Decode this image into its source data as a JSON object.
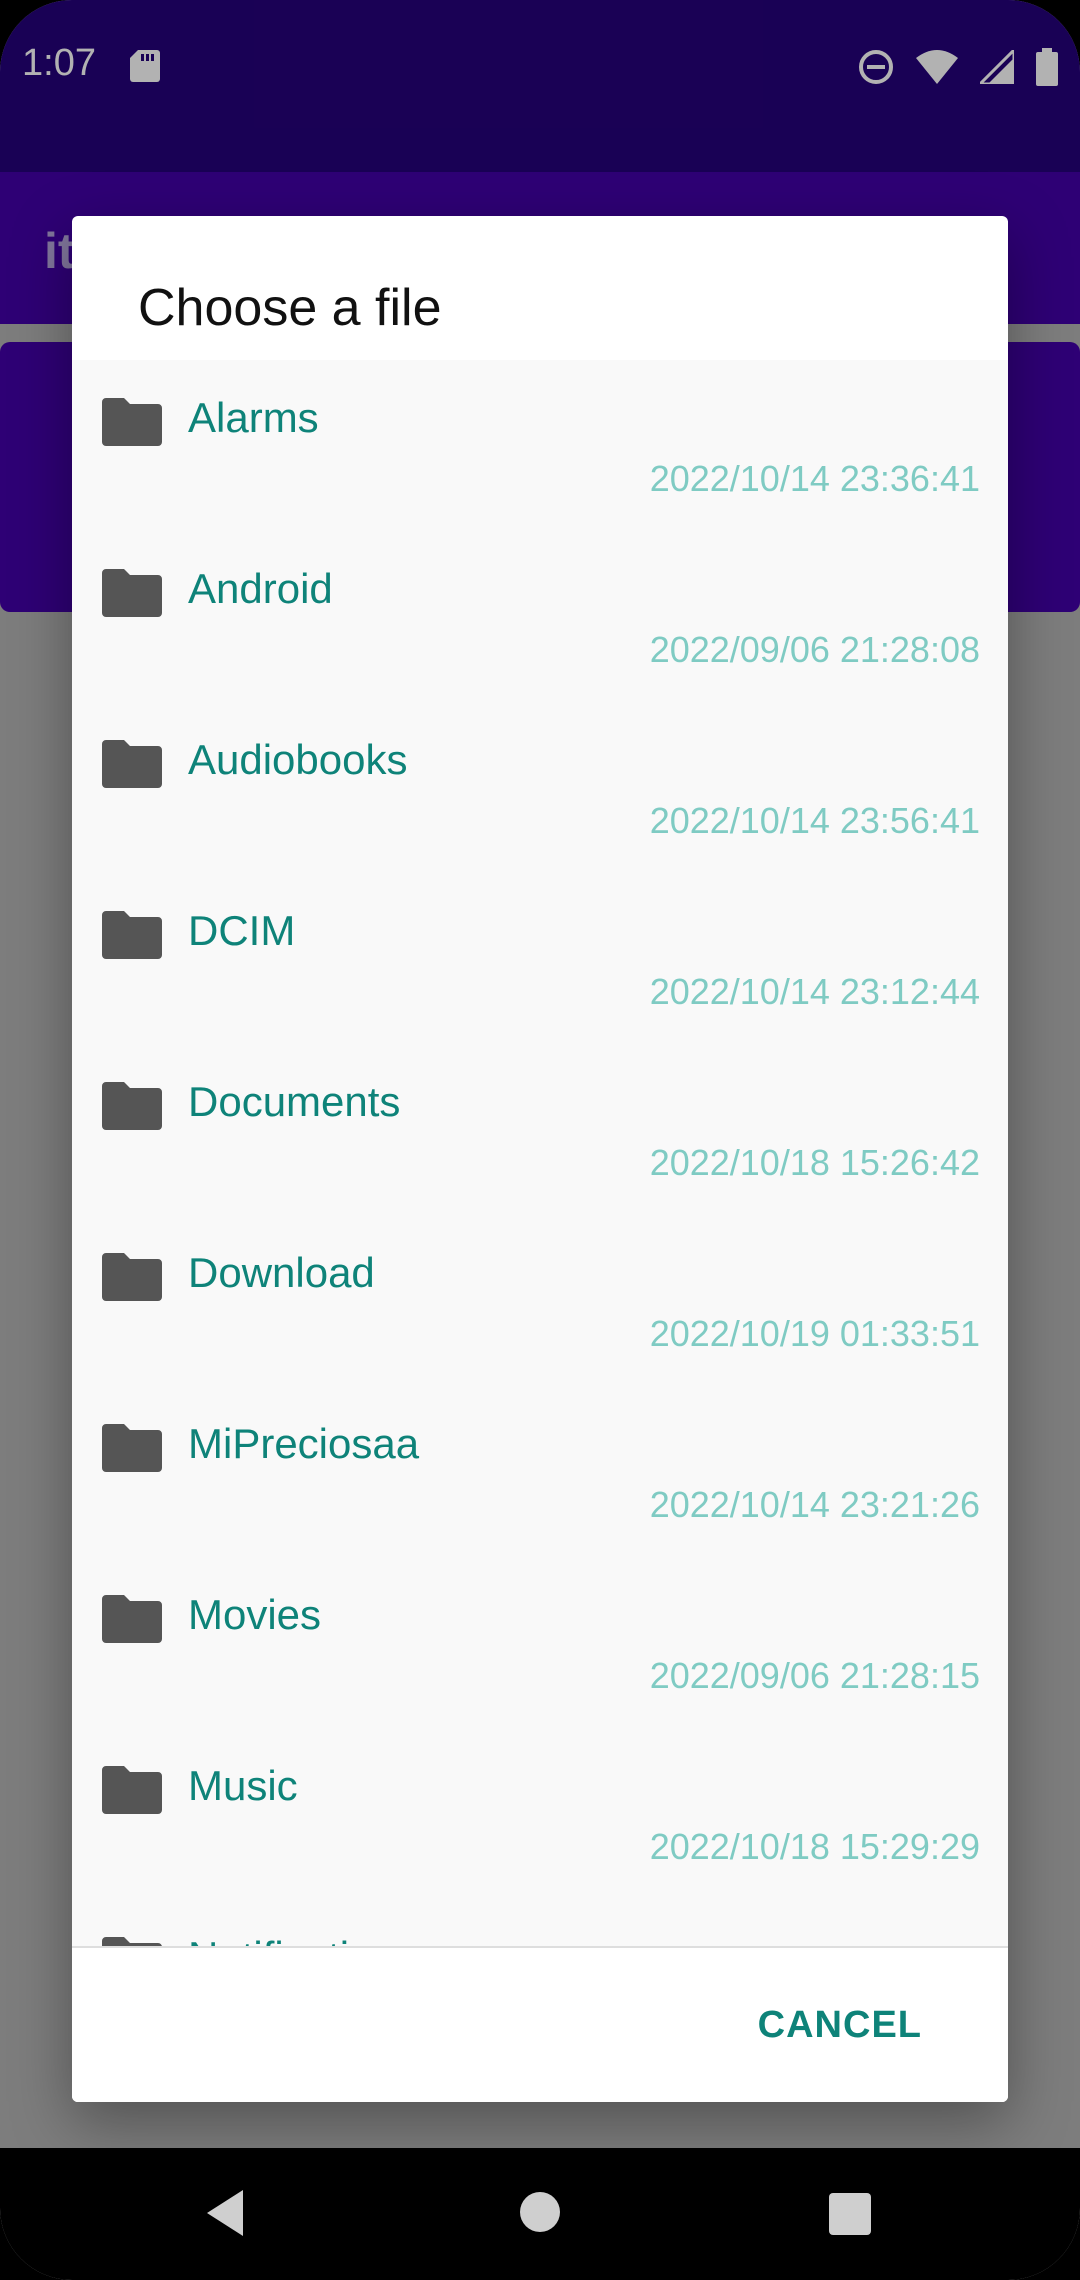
{
  "status_bar": {
    "time": "1:07",
    "icons": [
      "sd-card-icon",
      "dnd-icon",
      "wifi-icon",
      "signal-icon",
      "battery-icon"
    ]
  },
  "app_bar": {
    "title_partial": "it"
  },
  "dialog": {
    "title": "Choose a file",
    "files": [
      {
        "name": "Alarms",
        "date": "2022/10/14 23:36:41",
        "icon": "folder-icon"
      },
      {
        "name": "Android",
        "date": "2022/09/06 21:28:08",
        "icon": "folder-icon"
      },
      {
        "name": "Audiobooks",
        "date": "2022/10/14 23:56:41",
        "icon": "folder-icon"
      },
      {
        "name": "DCIM",
        "date": "2022/10/14 23:12:44",
        "icon": "folder-icon"
      },
      {
        "name": "Documents",
        "date": "2022/10/18 15:26:42",
        "icon": "folder-icon"
      },
      {
        "name": "Download",
        "date": "2022/10/19 01:33:51",
        "icon": "folder-icon"
      },
      {
        "name": "MiPreciosaa",
        "date": "2022/10/14 23:21:26",
        "icon": "folder-icon"
      },
      {
        "name": "Movies",
        "date": "2022/09/06 21:28:15",
        "icon": "folder-icon"
      },
      {
        "name": "Music",
        "date": "2022/10/18 15:29:29",
        "icon": "folder-icon"
      },
      {
        "name": "Notifications",
        "date": "",
        "icon": "folder-icon"
      }
    ],
    "cancel_label": "CANCEL"
  },
  "colors": {
    "status_bar": "#25027a",
    "app_bar": "#4301a8",
    "accent_text": "#0e8379",
    "date_text": "#7fcbc3"
  }
}
